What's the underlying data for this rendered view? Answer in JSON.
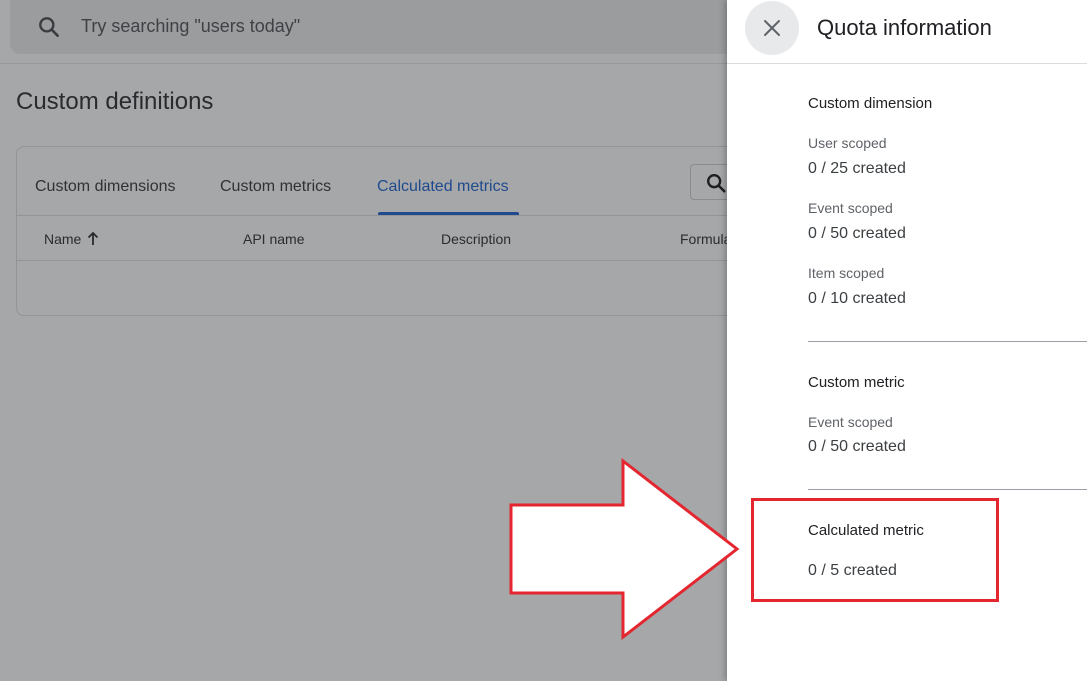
{
  "search": {
    "placeholder": "Try searching \"users today\""
  },
  "page": {
    "title": "Custom definitions"
  },
  "tabs": [
    {
      "label": "Custom dimensions",
      "active": false
    },
    {
      "label": "Custom metrics",
      "active": false
    },
    {
      "label": "Calculated metrics",
      "active": true
    }
  ],
  "table": {
    "columns": [
      "Name",
      "API name",
      "Description",
      "Formula"
    ]
  },
  "panel": {
    "title": "Quota information",
    "sections": [
      {
        "title": "Custom dimension",
        "scopes": [
          {
            "label": "User scoped",
            "value": "0 / 25 created"
          },
          {
            "label": "Event scoped",
            "value": "0 / 50 created"
          },
          {
            "label": "Item scoped",
            "value": "0 / 10 created"
          }
        ]
      },
      {
        "title": "Custom metric",
        "scopes": [
          {
            "label": "Event scoped",
            "value": "0 / 50 created"
          }
        ]
      },
      {
        "title": "Calculated metric",
        "value": "0 / 5 created"
      }
    ]
  },
  "colors": {
    "accent": "#1f4a8d",
    "annotation": "#e3262f",
    "overlay": "#a6a7a9"
  },
  "icons": {
    "search": "search-icon",
    "close": "close-icon",
    "sort": "arrow-up-icon"
  }
}
